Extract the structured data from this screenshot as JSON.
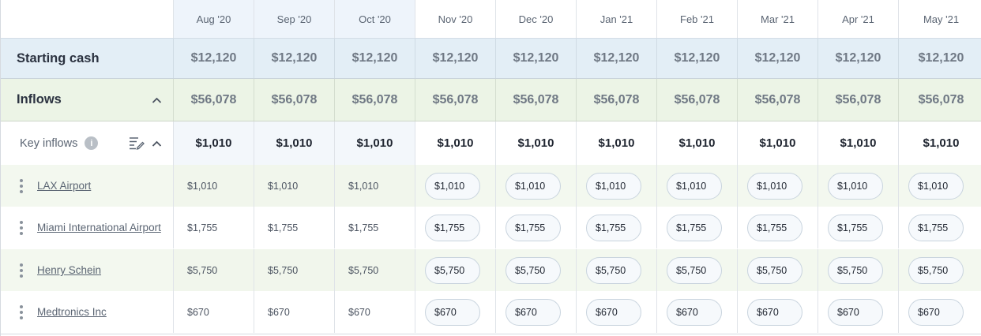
{
  "months": [
    "Aug  '20",
    "Sep  '20",
    "Oct  '20",
    "Nov  '20",
    "Dec '20",
    "Jan '21",
    "Feb '21",
    "Mar '21",
    "Apr '21",
    "May '21"
  ],
  "starting_cash": {
    "label": "Starting cash",
    "values": [
      "$12,120",
      "$12,120",
      "$12,120",
      "$12,120",
      "$12,120",
      "$12,120",
      "$12,120",
      "$12,120",
      "$12,120",
      "$12,120"
    ]
  },
  "inflows": {
    "label": "Inflows",
    "values": [
      "$56,078",
      "$56,078",
      "$56,078",
      "$56,078",
      "$56,078",
      "$56,078",
      "$56,078",
      "$56,078",
      "$56,078",
      "$56,078"
    ]
  },
  "key_inflows": {
    "label": "Key inflows",
    "info_icon": "i",
    "values": [
      "$1,010",
      "$1,010",
      "$1,010",
      "$1,010",
      "$1,010",
      "$1,010",
      "$1,010",
      "$1,010",
      "$1,010",
      "$1,010"
    ]
  },
  "items": [
    {
      "name": "LAX Airport",
      "values": [
        "$1,010",
        "$1,010",
        "$1,010",
        "$1,010",
        "$1,010",
        "$1,010",
        "$1,010",
        "$1,010",
        "$1,010",
        "$1,010"
      ]
    },
    {
      "name": "Miami International Airport",
      "values": [
        "$1,755",
        "$1,755",
        "$1,755",
        "$1,755",
        "$1,755",
        "$1,755",
        "$1,755",
        "$1,755",
        "$1,755",
        "$1,755"
      ]
    },
    {
      "name": "Henry Schein",
      "values": [
        "$5,750",
        "$5,750",
        "$5,750",
        "$5,750",
        "$5,750",
        "$5,750",
        "$5,750",
        "$5,750",
        "$5,750",
        "$5,750"
      ]
    },
    {
      "name": "Medtronics Inc",
      "values": [
        "$670",
        "$670",
        "$670",
        "$670",
        "$670",
        "$670",
        "$670",
        "$670",
        "$670",
        "$670"
      ]
    }
  ],
  "actual_month_count": 3,
  "icons": {
    "collapse": "chevron-up-icon",
    "row_menu": "kebab-menu-icon",
    "edit_list": "list-edit-icon",
    "info": "info-icon"
  },
  "colors": {
    "starting_bg": "#e3eef6",
    "inflow_bg": "#ecf4e6",
    "item_shade": "#f3f8ef",
    "pill_border": "#c9d4de"
  }
}
